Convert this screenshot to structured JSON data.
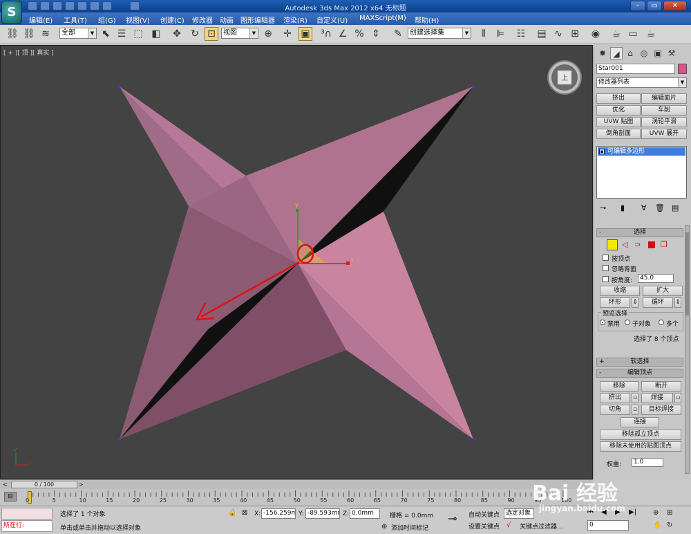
{
  "window": {
    "title": "Autodesk 3ds Max  2012 x64     无标题",
    "logo_glyph": "S"
  },
  "menu": [
    "编辑(E)",
    "工具(T)",
    "组(G)",
    "视图(V)",
    "创建(C)",
    "修改器",
    "动画",
    "图形编辑器",
    "渲染(R)",
    "自定义(U)",
    "MAXScript(M)",
    "帮助(H)"
  ],
  "toolbar": {
    "selection_filter": "全部",
    "reference_coord": "视图",
    "named_selection": "创建选择集"
  },
  "viewport": {
    "label": "[ + ][ 顶 ][ 真实 ]",
    "viewcube_label": "上",
    "axis_x": "x",
    "axis_y": "y",
    "object_color": "#c27fa0"
  },
  "command_panel": {
    "object_name": "Star001",
    "object_color": "#e0508c",
    "modifier_list": "修改器列表",
    "modifier_buttons": [
      "挤出",
      "编辑面片",
      "优化",
      "车削",
      "UVW 贴图",
      "涡轮平滑",
      "倒角剖面",
      "UVW 展开"
    ],
    "stack_item": "可编辑多边形",
    "selection_rollout": {
      "title": "选择",
      "by_vertex": "按顶点",
      "ignore_backfacing": "忽略背面",
      "by_angle": "按角度:",
      "angle_value": "45.0",
      "shrink": "收缩",
      "grow": "扩大",
      "ring": "环形",
      "loop": "循环",
      "preview_label": "预览选择",
      "preview_disable": "禁用",
      "preview_subobj": "子对象",
      "preview_multi": "多个",
      "status": "选择了 8 个顶点"
    },
    "soft_selection": "软选择",
    "edit_vertices": {
      "title": "编辑顶点",
      "remove": "移除",
      "break": "断开",
      "extrude": "挤出",
      "weld": "焊接",
      "chamfer": "切角",
      "target_weld": "目标焊接",
      "connect": "连接",
      "remove_isolated": "移除孤立顶点",
      "remove_unused_map": "移除未使用的贴图顶点",
      "weight_label": "权重:",
      "weight_value": "1.0"
    }
  },
  "timeline": {
    "frame_display": "0 / 100",
    "ticks": [
      "0",
      "5",
      "10",
      "15",
      "20",
      "25",
      "30",
      "35",
      "40",
      "45",
      "50",
      "55",
      "60",
      "65",
      "70",
      "75",
      "80",
      "85",
      "90",
      "95",
      "100"
    ]
  },
  "status": {
    "running_label": "所在行:",
    "selected": "选择了 1 个对象",
    "prompt": "单击或单击并拖动以选择对象",
    "x_label": "X:",
    "x_value": "-156.259m",
    "y_label": "Y:",
    "y_value": "-89.593mm",
    "z_label": "Z:",
    "z_value": "0.0mm",
    "grid": "栅格 = 0.0mm",
    "add_time_tag": "添加时间标记",
    "auto_key": "自动关键点",
    "set_key": "设置关键点",
    "selected_object": "选定对象",
    "key_filters": "关键点过滤器..."
  },
  "watermark": {
    "brand": "Bai 经验",
    "url": "jingyan.baidu.com"
  }
}
